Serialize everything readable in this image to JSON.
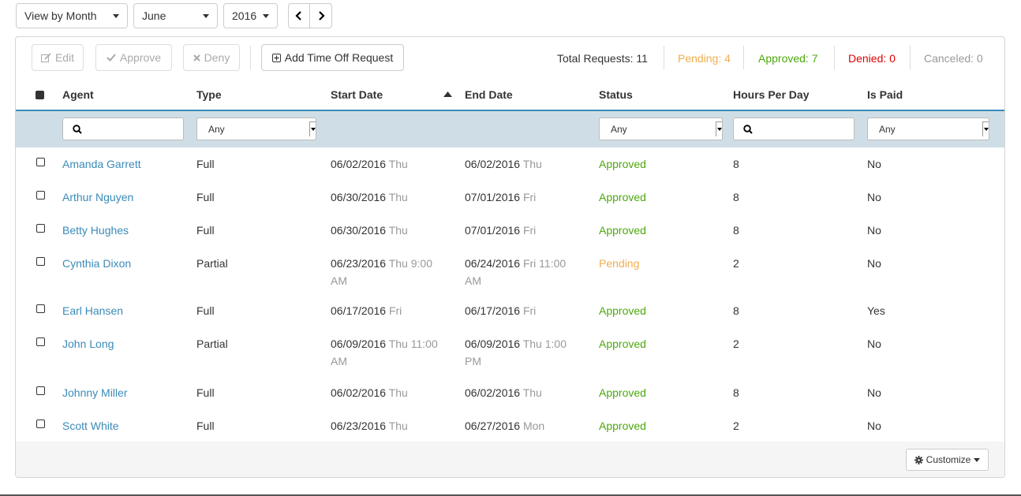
{
  "filters_top": {
    "view": "View by Month",
    "month": "June",
    "year": "2016"
  },
  "toolbar": {
    "edit": "Edit",
    "approve": "Approve",
    "deny": "Deny",
    "add": "Add Time Off Request",
    "total": "Total Requests: 11",
    "pending": "Pending: 4",
    "approved": "Approved: 7",
    "denied": "Denied: 0",
    "canceled": "Canceled: 0"
  },
  "columns": {
    "agent": "Agent",
    "type": "Type",
    "start": "Start Date",
    "end": "End Date",
    "status": "Status",
    "hours": "Hours Per Day",
    "paid": "Is Paid"
  },
  "filter_row": {
    "type": "Any",
    "status": "Any",
    "paid": "Any"
  },
  "rows": [
    {
      "agent": "Amanda Garrett",
      "type": "Full",
      "start": "06/02/2016",
      "start_sub": "Thu",
      "end": "06/02/2016",
      "end_sub": "Thu",
      "status": "Approved",
      "hours": "8",
      "paid": "No"
    },
    {
      "agent": "Arthur Nguyen",
      "type": "Full",
      "start": "06/30/2016",
      "start_sub": "Thu",
      "end": "07/01/2016",
      "end_sub": "Fri",
      "status": "Approved",
      "hours": "8",
      "paid": "No"
    },
    {
      "agent": "Betty Hughes",
      "type": "Full",
      "start": "06/30/2016",
      "start_sub": "Thu",
      "end": "07/01/2016",
      "end_sub": "Fri",
      "status": "Approved",
      "hours": "8",
      "paid": "No"
    },
    {
      "agent": "Cynthia Dixon",
      "type": "Partial",
      "start": "06/23/2016",
      "start_sub": "Thu 9:00 AM",
      "end": "06/24/2016",
      "end_sub": "Fri 11:00 AM",
      "status": "Pending",
      "hours": "2",
      "paid": "No"
    },
    {
      "agent": "Earl Hansen",
      "type": "Full",
      "start": "06/17/2016",
      "start_sub": "Fri",
      "end": "06/17/2016",
      "end_sub": "Fri",
      "status": "Approved",
      "hours": "8",
      "paid": "Yes"
    },
    {
      "agent": "John Long",
      "type": "Partial",
      "start": "06/09/2016",
      "start_sub": "Thu 11:00 AM",
      "end": "06/09/2016",
      "end_sub": "Thu 1:00 PM",
      "status": "Approved",
      "hours": "2",
      "paid": "No"
    },
    {
      "agent": "Johnny Miller",
      "type": "Full",
      "start": "06/02/2016",
      "start_sub": "Thu",
      "end": "06/02/2016",
      "end_sub": "Thu",
      "status": "Approved",
      "hours": "8",
      "paid": "No"
    },
    {
      "agent": "Scott White",
      "type": "Full",
      "start": "06/23/2016",
      "start_sub": "Thu",
      "end": "06/27/2016",
      "end_sub": "Mon",
      "status": "Approved",
      "hours": "2",
      "paid": "No"
    }
  ],
  "footer": {
    "customize": "Customize"
  },
  "colors": {
    "link": "#3a8bb8",
    "approved": "#4da80c",
    "pending": "#f0ad4e",
    "denied": "#e00000",
    "filter_bg": "#cfdee6"
  }
}
